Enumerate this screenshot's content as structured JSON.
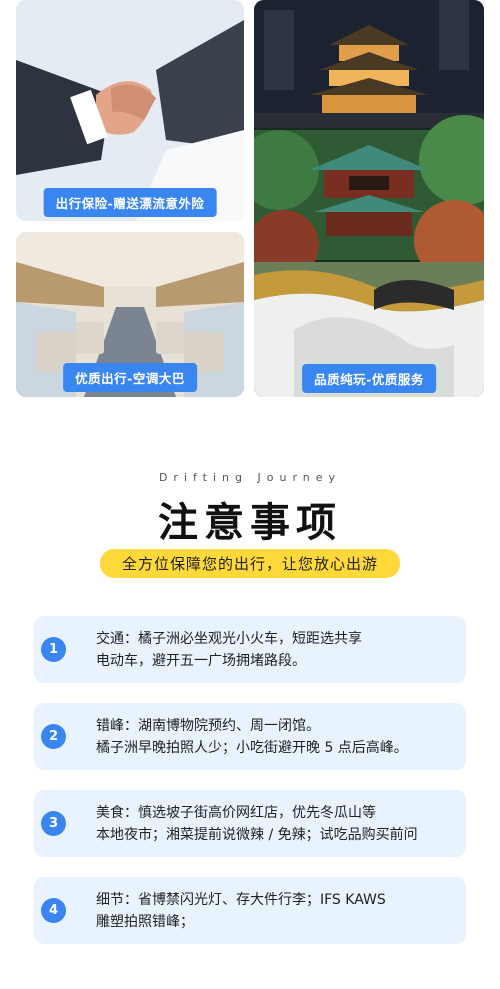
{
  "photos": {
    "handshake_caption": "出行保险-赠送漂流意外险",
    "bus_caption": "优质出行-空调大巴",
    "scenery_caption": "品质纯玩-优质服务"
  },
  "header": {
    "subtitle_en": "Drifting Journey",
    "title": "注意事项",
    "tagline": "全方位保障您的出行，让您放心出游"
  },
  "tips": [
    {
      "num": "1",
      "line1": "交通：橘子洲必坐观光小火车，短距选共享",
      "line2": "电动车，避开五一广场拥堵路段。"
    },
    {
      "num": "2",
      "line1": "错峰：湖南博物院预约、周一闭馆。",
      "line2": "橘子洲早晚拍照人少；小吃街避开晚 5 点后高峰。"
    },
    {
      "num": "3",
      "line1": "美食：慎选坡子街高价网红店，优先冬瓜山等",
      "line2": "本地夜市；湘菜提前说微辣 / 免辣；试吃品购买前问"
    },
    {
      "num": "4",
      "line1": "细节：省博禁闪光灯、存大件行李；IFS KAWS",
      "line2": "雕塑拍照错峰；"
    }
  ],
  "colors": {
    "accent": "#3a86f0",
    "card_bg": "#e9f2ff",
    "tagline_bg": "#ffd93a"
  }
}
